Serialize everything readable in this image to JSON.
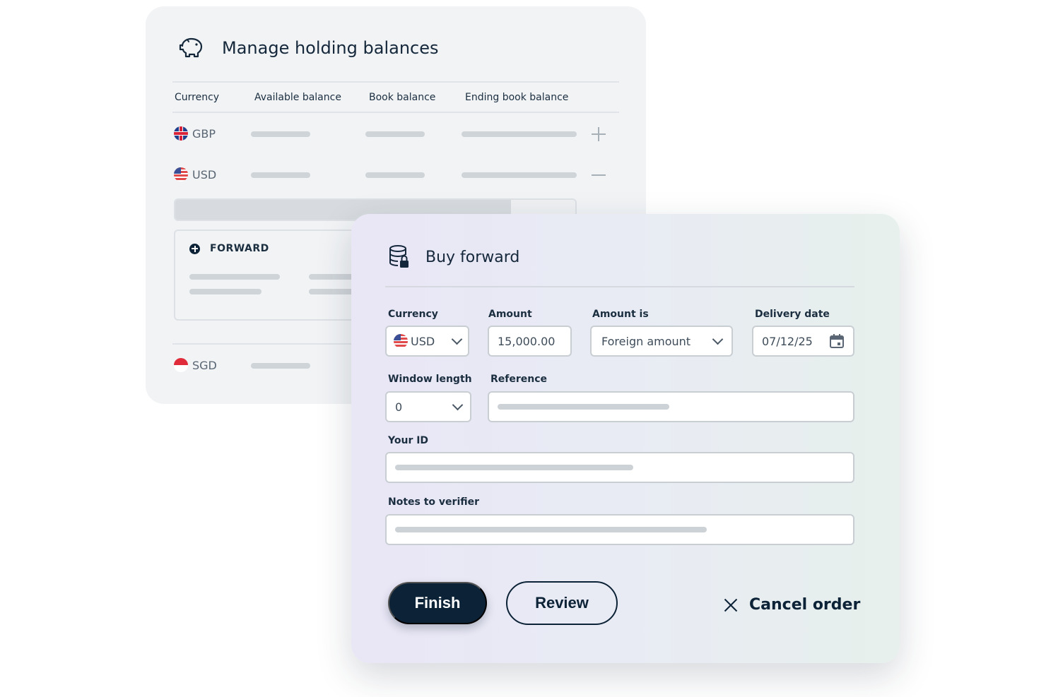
{
  "holdings": {
    "title": "Manage holding balances",
    "columns": [
      "Currency",
      "Available balance",
      "Book balance",
      "Ending book balance"
    ],
    "rows": [
      {
        "code": "GBP",
        "action_icon": "plus-icon"
      },
      {
        "code": "USD",
        "action_icon": "minus-icon"
      },
      {
        "code": "SGD"
      }
    ],
    "progress_fraction": 0.84,
    "forward_label": "FORWARD"
  },
  "buy_forward": {
    "title": "Buy forward",
    "currency_label": "Currency",
    "currency_value": "USD",
    "amount_label": "Amount",
    "amount_value": "15,000.00",
    "amount_is_label": "Amount is",
    "amount_is_value": "Foreign amount",
    "delivery_date_label": "Delivery date",
    "delivery_date_value": "07/12/25",
    "window_length_label": "Window length",
    "window_length_value": "0",
    "reference_label": "Reference",
    "your_id_label": "Your ID",
    "notes_label": "Notes to verifier",
    "finish_label": "Finish",
    "review_label": "Review",
    "cancel_label": "Cancel order"
  },
  "colors": {
    "navy": "#0c2236",
    "card_bg": "#f1f3f5",
    "placeholder_pill": "#cdd2d7"
  }
}
